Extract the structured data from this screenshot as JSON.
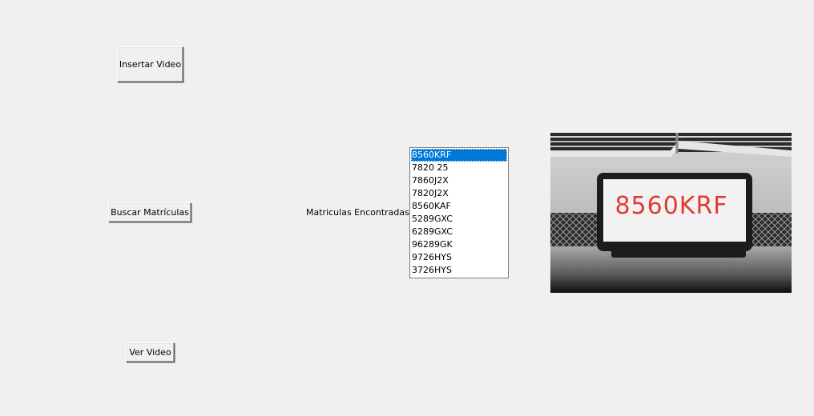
{
  "buttons": {
    "insert_video": "Insertar Video",
    "search_plates": "Buscar Matrículas",
    "view_video": "Ver Video"
  },
  "found_label": "Matriculas Encontradas:",
  "plates_list": {
    "items": [
      "8560KRF",
      "7820 25",
      "7860J2X",
      "7820J2X",
      "8560KAF",
      "5289GXC",
      "6289GXC",
      "96289GK",
      "9726HYS",
      "3726HYS"
    ],
    "selected_index": 0
  },
  "preview": {
    "plate_text": "8560KRF",
    "plate_color": "#e23a32"
  }
}
